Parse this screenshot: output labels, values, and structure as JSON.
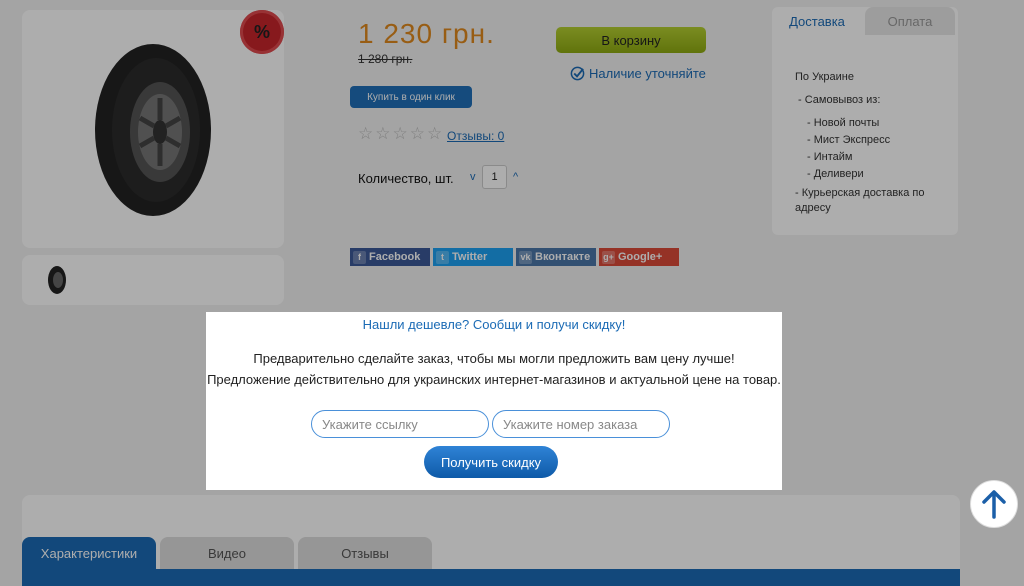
{
  "product": {
    "sale_badge": "%",
    "price": "1 230 грн.",
    "old_price": "1 280 грн.",
    "cart_label": "В корзину",
    "stock_label": "Наличие уточняйте",
    "oneclick_label": "Купить в один клик",
    "rating": 0,
    "max_rating": 5,
    "reviews_label": "Отзывы: 0",
    "qty_label": "Количество, шт.",
    "qty_value": "1",
    "qty_dec": "v",
    "qty_inc": "^"
  },
  "social": [
    {
      "label": "Facebook",
      "icon": "f"
    },
    {
      "label": "Twitter",
      "icon": "t"
    },
    {
      "label": "Вконтакте",
      "icon": "vk"
    },
    {
      "label": "Google+",
      "icon": "g+"
    }
  ],
  "delivery": {
    "tab_delivery": "Доставка",
    "tab_payment": "Оплата",
    "heading": "По Украине",
    "pickup": "- Самовывоз из:",
    "items": [
      "- Новой почты",
      "- Мист Экспресс",
      "- Интайм",
      "- Деливери"
    ],
    "courier": "- Курьерская доставка по",
    "courier2": "адресу"
  },
  "bottom_tabs": [
    "Характеристики",
    "Видео",
    "Отзывы"
  ],
  "modal": {
    "title": "Нашли дешевле? Сообщи и получи скидку!",
    "line1": "Предварительно сделайте заказ, чтобы мы могли предложить вам цену лучше!",
    "line2": "Предложение действительно для украинских интернет-магазинов и актуальной цене на товар.",
    "link_placeholder": "Укажите ссылку",
    "order_placeholder": "Укажите номер заказа",
    "submit_label": "Получить скидку"
  },
  "scroll_top_icon": "arrow-up-icon"
}
